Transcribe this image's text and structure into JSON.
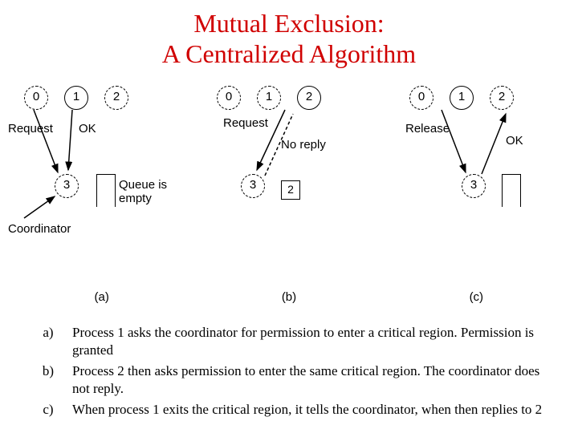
{
  "title_line1": "Mutual Exclusion:",
  "title_line2": "A Centralized Algorithm",
  "nodes": {
    "n0": "0",
    "n1": "1",
    "n2": "2",
    "n3": "3"
  },
  "panelA": {
    "request": "Request",
    "ok": "OK",
    "coordinator": "Coordinator",
    "queue_label": "Queue is\nempty",
    "caption": "(a)"
  },
  "panelB": {
    "request": "Request",
    "noreply": "No reply",
    "queue_value": "2",
    "caption": "(b)"
  },
  "panelC": {
    "release": "Release",
    "ok": "OK",
    "caption": "(c)"
  },
  "explain": {
    "a_key": "a)",
    "a_text": "Process 1 asks the coordinator for permission to enter a critical region. Permission is granted",
    "b_key": "b)",
    "b_text": "Process 2 then asks permission to enter the same critical region. The coordinator does not reply.",
    "c_key": "c)",
    "c_text": "When process 1 exits the critical region, it tells the coordinator, when then replies to 2"
  }
}
